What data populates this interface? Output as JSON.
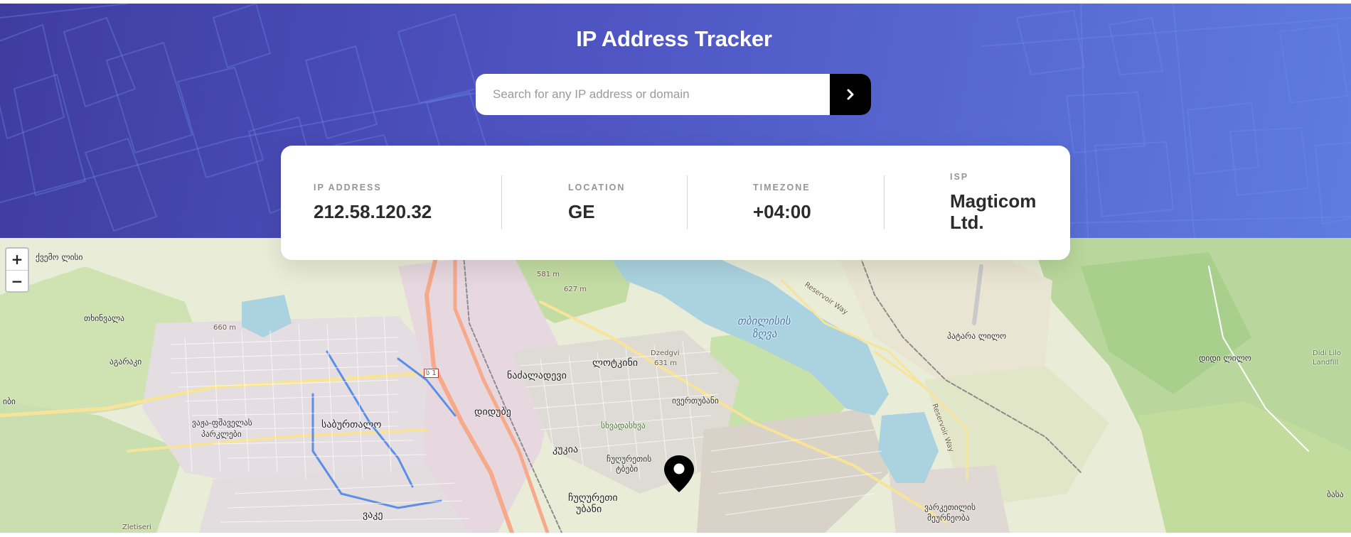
{
  "header": {
    "title": "IP Address Tracker",
    "colors": {
      "gradient_start": "#3f3ca0",
      "gradient_end": "#5f7ce0"
    }
  },
  "search": {
    "placeholder": "Search for any IP address or domain",
    "value": "",
    "button_icon": "chevron-right-icon"
  },
  "info": {
    "ip_label": "IP ADDRESS",
    "ip_value": "212.58.120.32",
    "location_label": "LOCATION",
    "location_value": "GE",
    "timezone_label": "TIMEZONE",
    "timezone_value": "+04:00",
    "isp_label": "ISP",
    "isp_value": "Magticom Ltd."
  },
  "map": {
    "zoom_in_label": "+",
    "zoom_out_label": "−",
    "marker_icon": "location-pin-icon",
    "labels": {
      "l1": "ქვემო ლისი",
      "l2": "თხინვალა",
      "l3": "აგარაკი",
      "l4": "660 m",
      "l5": "ვაჟა-ფშაველას",
      "l6": "პარკლები",
      "l7": "საბურთალო",
      "l8": "დიდუბე",
      "l9": "ნაძალადევი",
      "l10": "ლოტკინი",
      "l11": "თბილისის",
      "l12": "ზღვა",
      "l13": "Dzedgvi",
      "l14": "631 m",
      "l15": "627 m",
      "l16": "581 m",
      "l17": "ივერთუბანი",
      "l18": "კუკია",
      "l19": "ჩუღურეთის",
      "l20": "ტბები",
      "l21": "ვაკე",
      "l22": "ჩუღურეთი",
      "l23": "უბანი",
      "l24": "პატარა ლილო",
      "l25": "დიდი ლილო",
      "l26": "Didi Lilo",
      "l27": "Landfill",
      "l28": "ვარკეთილის",
      "l29": "მეურნეობა",
      "l30": "Zletiseri",
      "l31": "ს 1",
      "l32": "Reservoir Way",
      "l33": "Reservoir Way",
      "l34": "სხვადასხვა",
      "l35": "ბასა",
      "l36": "იბი"
    }
  }
}
